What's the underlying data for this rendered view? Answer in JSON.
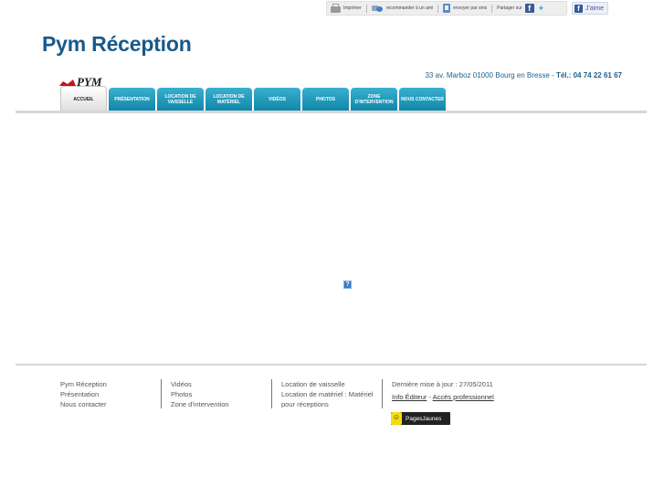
{
  "toolbar": {
    "print": "Imprimer",
    "recommend": "recommander à un ami",
    "send": "envoyer par sms",
    "share": "Partager sur",
    "like": "J'aime"
  },
  "header": {
    "site_title": "Pym Réception",
    "address": "33 av. Marboz 01000 Bourg en Bresse  -  ",
    "phone": "Tél.: 04 74 22 61 67",
    "logo_text": "PYM"
  },
  "nav": {
    "tabs": [
      {
        "label": "Accueil"
      },
      {
        "label": "Présentation"
      },
      {
        "label": "Location de vaisselle"
      },
      {
        "label": "Location de matériel"
      },
      {
        "label": "Vidéos"
      },
      {
        "label": "Photos"
      },
      {
        "label": "Zone d'intervention"
      },
      {
        "label": "Nous contacter"
      }
    ]
  },
  "main": {
    "plugin_placeholder": "?"
  },
  "footer": {
    "col1": [
      "Pym Réception",
      "Présentation",
      "Nous contacter"
    ],
    "col2": [
      "Vidéos",
      "Photos",
      "Zone d'intervention"
    ],
    "col3": [
      "Location de vaisselle",
      "Location de matériel : Matériel pour réceptions"
    ],
    "last_update": "Dernière mise à jour : 27/05/2011",
    "info_editor": "Info Éditeur",
    "separator": " - ",
    "pro_access": "Accès professionnel",
    "pages_jaunes": "PagesJaunes"
  },
  "colors": {
    "brand_blue": "#175a8a",
    "tab_teal": "#1d97bb",
    "fb_blue": "#3b5998"
  }
}
